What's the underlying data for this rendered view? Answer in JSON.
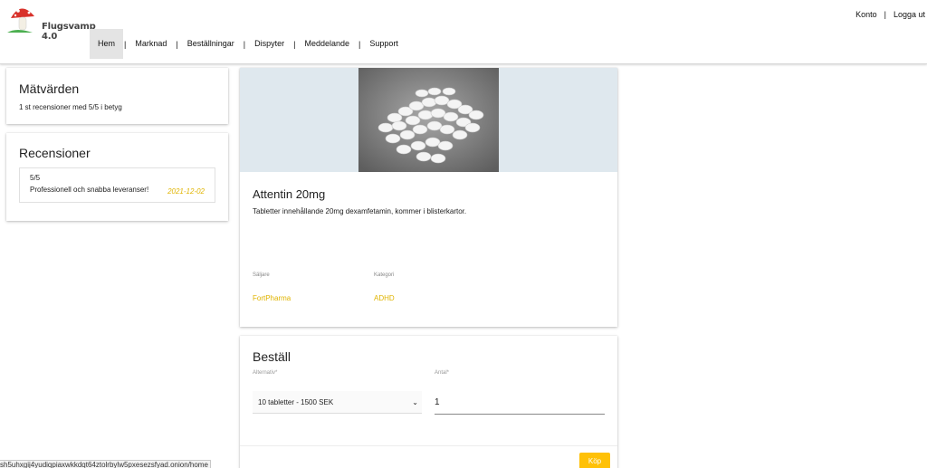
{
  "app": {
    "name": "Flugsvamp 4.0"
  },
  "top_links": {
    "account": "Konto",
    "separator": "|",
    "logout": "Logga ut"
  },
  "nav": {
    "items": [
      "Hem",
      "Marknad",
      "Beställningar",
      "Dispyter",
      "Meddelande",
      "Support"
    ],
    "separator": "|",
    "active": "Hem"
  },
  "metrics": {
    "title": "Mätvärden",
    "summary": "1 st recensioner med 5/5 i betyg"
  },
  "reviews": {
    "title": "Recensioner",
    "items": [
      {
        "rating": "5/5",
        "text": "Professionell och snabba leveranser!",
        "date": "2021-12-02"
      }
    ]
  },
  "product": {
    "title": "Attentin 20mg",
    "description": "Tabletter innehållande 20mg dexamfetamin, kommer i blisterkartor.",
    "seller_label": "Säljare",
    "seller": "FortPharma",
    "category_label": "Kategori",
    "category": "ADHD",
    "image_icon": "white-pills-photo"
  },
  "order": {
    "title": "Beställ",
    "option_label": "Alternativ*",
    "option_value": "10 tabletter - 1500 SEK",
    "quantity_label": "Antal*",
    "quantity_value": "1",
    "buy_label": "Köp"
  },
  "status_bar": {
    "url": "sh5uhxgij4yudiqpiaxwkkdqt64ztolrbylw5pxesezsfyad.onion/home"
  },
  "colors": {
    "accent": "#ffc107",
    "link": "#e0b400",
    "image_bg": "#dfe8ee"
  }
}
